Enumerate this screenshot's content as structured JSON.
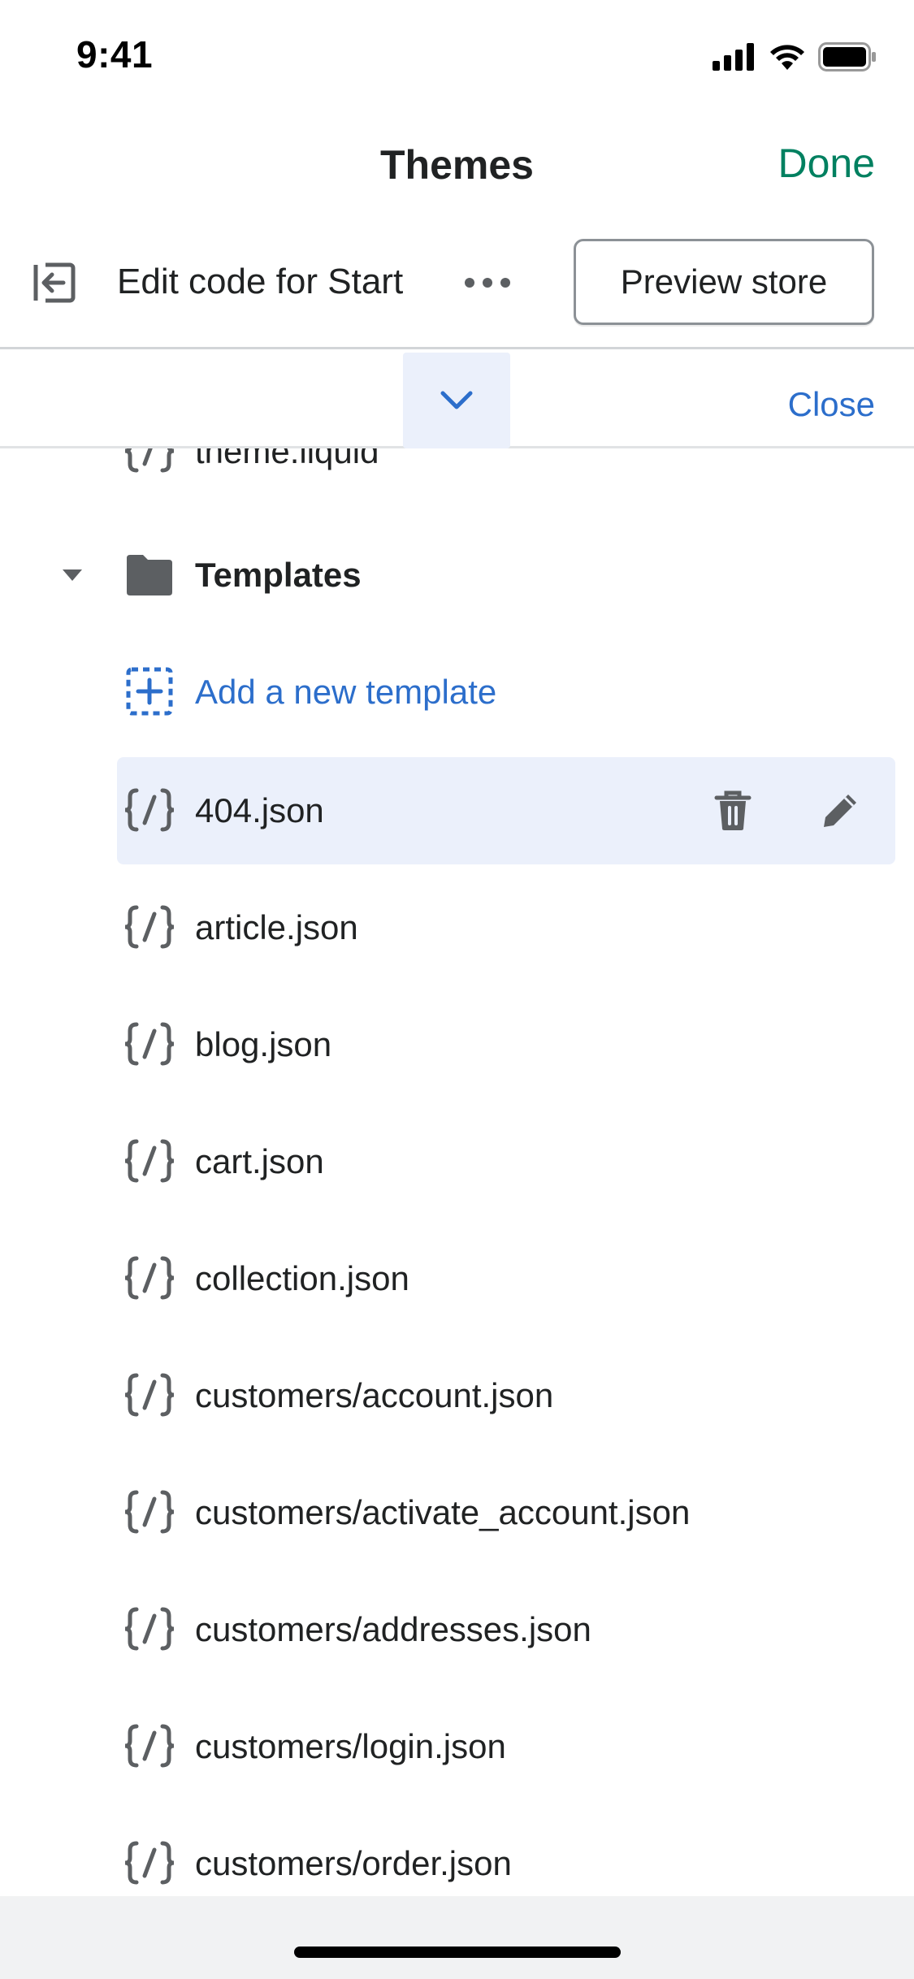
{
  "status_bar": {
    "time": "9:41"
  },
  "nav": {
    "title": "Themes",
    "done_label": "Done"
  },
  "toolbar": {
    "title": "Edit code for Start",
    "preview_label": "Preview store"
  },
  "panel": {
    "close_label": "Close"
  },
  "files": {
    "partial_item": "theme.liquid",
    "folder_label": "Templates",
    "add_label": "Add a new template",
    "items": [
      "404.json",
      "article.json",
      "blog.json",
      "cart.json",
      "collection.json",
      "customers/account.json",
      "customers/activate_account.json",
      "customers/addresses.json",
      "customers/login.json",
      "customers/order.json"
    ]
  },
  "colors": {
    "done_green": "#008060",
    "link_blue": "#2c6ecb",
    "selected_bg": "#ebf0fb",
    "icon_gray": "#5c5f62"
  }
}
